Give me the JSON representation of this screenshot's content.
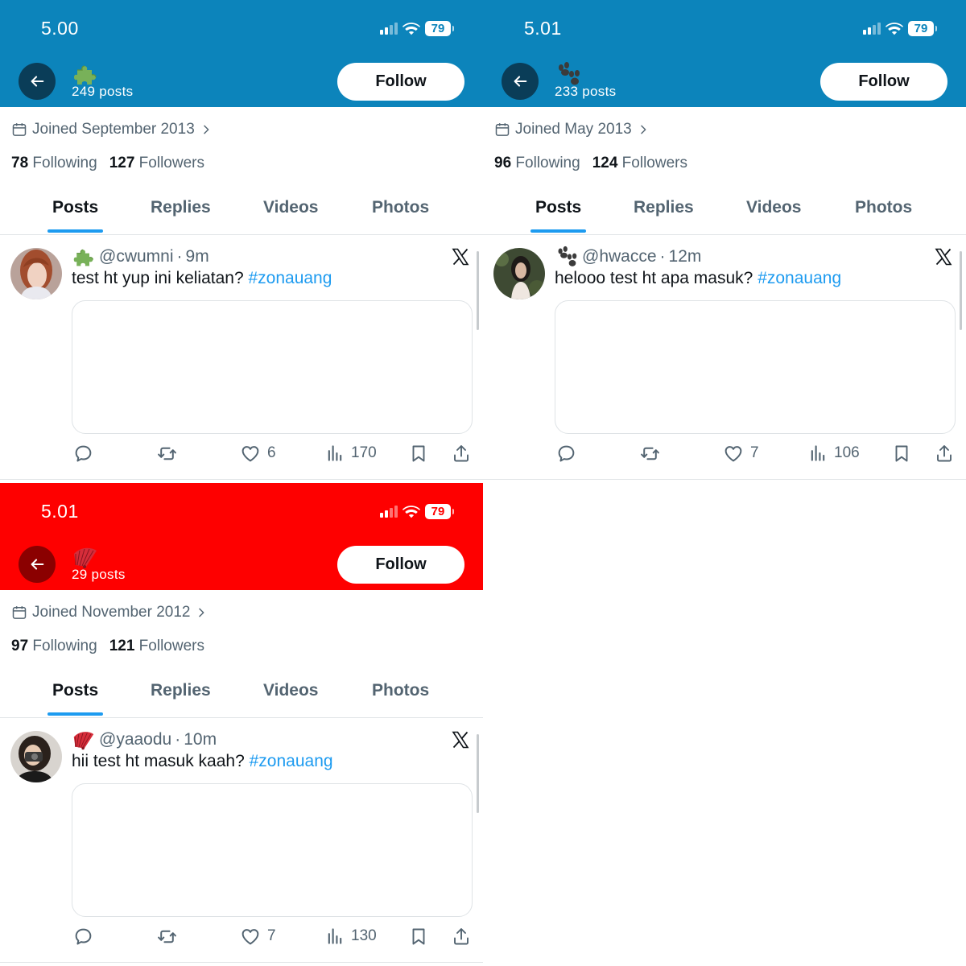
{
  "colors": {
    "blue_header": "#0c84bb",
    "blue_back": "#0a3d58",
    "red_header": "#fe0000",
    "red_back": "#8b0000",
    "link": "#1d9bf0",
    "secondary_text": "#536471"
  },
  "tabs": [
    "Posts",
    "Replies",
    "Videos",
    "Photos"
  ],
  "panels": [
    {
      "time": "5.00",
      "battery": "79",
      "emoji_icon": "puzzle-piece-icon",
      "posts": "249 posts",
      "follow": "Follow",
      "joined": "Joined September 2013",
      "following_count": "78",
      "following_label": "Following",
      "followers_count": "127",
      "followers_label": "Followers",
      "handle": "@cwumni",
      "age": "9m",
      "text": "test ht yup ini keliatan?",
      "hashtag": "#zonauang",
      "likes": "6",
      "views": "170"
    },
    {
      "time": "5.01",
      "battery": "79",
      "emoji_icon": "paw-prints-icon",
      "posts": "233 posts",
      "follow": "Follow",
      "joined": "Joined May 2013",
      "following_count": "96",
      "following_label": "Following",
      "followers_count": "124",
      "followers_label": "Followers",
      "handle": "@hwacce",
      "age": "12m",
      "text": "helooo test ht apa masuk?",
      "hashtag": "#zonauang",
      "likes": "7",
      "views": "106"
    },
    {
      "time": "5.01",
      "battery": "79",
      "emoji_icon": "folding-fan-icon",
      "posts": "29 posts",
      "follow": "Follow",
      "joined": "Joined November 2012",
      "following_count": "97",
      "following_label": "Following",
      "followers_count": "121",
      "followers_label": "Followers",
      "handle": "@yaaodu",
      "age": "10m",
      "text": "hii test ht masuk kaah?",
      "hashtag": "#zonauang",
      "likes": "7",
      "views": "130"
    }
  ]
}
